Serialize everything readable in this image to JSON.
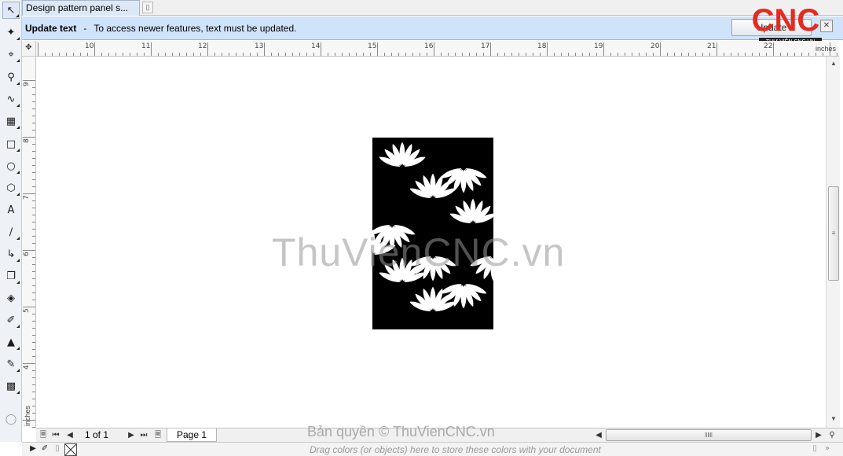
{
  "document_tab": {
    "title": "Design pattern panel s...",
    "close": "▯"
  },
  "notification": {
    "title": "Update text",
    "separator": "-",
    "message": "To access newer features, text must be updated.",
    "button": "Update"
  },
  "logo": {
    "text": "CNC",
    "subtitle": "THƯ VIỆN CNC.VN"
  },
  "ruler": {
    "h_ticks": [
      "10",
      "11",
      "12",
      "13",
      "14",
      "15",
      "16",
      "17",
      "18",
      "19",
      "20",
      "21",
      "22"
    ],
    "v_ticks": [
      "9",
      "8",
      "7",
      "6",
      "5",
      "4"
    ],
    "units_h": "inches",
    "units_v": "inches"
  },
  "canvas": {
    "watermark": "ThuVienCNC.vn"
  },
  "pagebar": {
    "page_count": "1 of 1",
    "page_tab": "Page 1",
    "copyright": "Bản quyền © ThuVienCNC.vn"
  },
  "palette": {
    "hint": "Drag colors (or objects) here to store these colors with your document"
  },
  "colors": {
    "notify_bg": "#cfe3fb",
    "logo_red": "#e52a1f",
    "panel": "#000000"
  },
  "tools": [
    "pick-tool-icon",
    "shape-tool-icon",
    "crop-tool-icon",
    "zoom-tool-icon",
    "freehand-tool-icon",
    "smart-fill-icon",
    "rectangle-tool-icon",
    "ellipse-tool-icon",
    "polygon-tool-icon",
    "text-tool-icon",
    "dimension-tool-icon",
    "connector-tool-icon",
    "drop-shadow-tool-icon",
    "transparency-tool-icon",
    "eyedropper-tool-icon",
    "interactive-fill-icon",
    "smart-fill-tool-icon",
    "outline-pen-icon"
  ]
}
